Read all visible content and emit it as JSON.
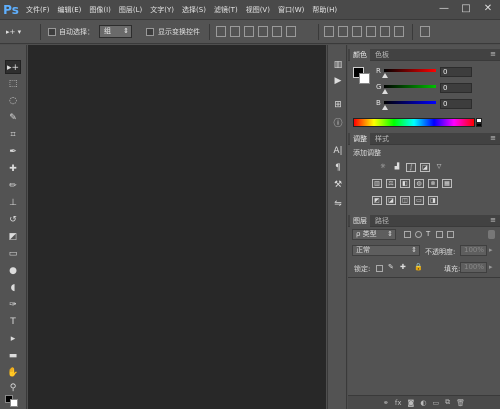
{
  "app": {
    "logo": "Ps"
  },
  "menubar": {
    "items": [
      "文件(F)",
      "编辑(E)",
      "图像(I)",
      "图层(L)",
      "文字(Y)",
      "选择(S)",
      "滤镜(T)",
      "视图(V)",
      "窗口(W)",
      "帮助(H)"
    ],
    "window_controls": {
      "minimize": "—",
      "maximize": "□",
      "close": "✕"
    }
  },
  "options_bar": {
    "auto_select_label": "自动选择：",
    "auto_select_value": "组",
    "show_transform_label": "显示变换控件"
  },
  "color_panel": {
    "tabs": [
      "颜色",
      "色板"
    ],
    "channels": [
      {
        "name": "R",
        "value": "0",
        "color": "#ff0000"
      },
      {
        "name": "G",
        "value": "0",
        "color": "#00c000"
      },
      {
        "name": "B",
        "value": "0",
        "color": "#0000ff"
      }
    ],
    "foreground": "#000000",
    "background": "#ffffff"
  },
  "adjustments_panel": {
    "tabs": [
      "调整",
      "样式"
    ],
    "title": "添加调整"
  },
  "layers_panel": {
    "tabs": [
      "图层",
      "路径"
    ],
    "filter_kind": "ρ 类型",
    "blend_mode": "正常",
    "opacity_label": "不透明度:",
    "opacity_value": "100%",
    "lock_label": "锁定:",
    "fill_label": "填充:",
    "fill_value": "100%"
  }
}
